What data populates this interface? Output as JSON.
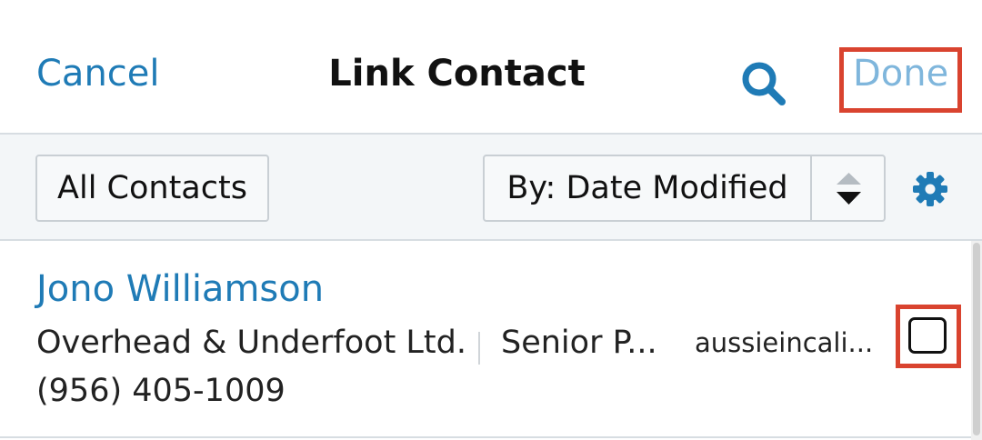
{
  "header": {
    "cancel_label": "Cancel",
    "title": "Link Contact",
    "done_label": "Done"
  },
  "toolbar": {
    "filter_label": "All Contacts",
    "sort_label": "By: Date Modified"
  },
  "records": [
    {
      "name": "Jono Williamson",
      "company": "Overhead & Underfoot Ltd.",
      "title": "Senior P...",
      "email": "aussieincali...",
      "phone": "(956) 405-1009",
      "checked": false
    }
  ],
  "icons": {
    "search": "search-icon",
    "sort": "sort-arrows-icon",
    "settings": "gear-icon"
  },
  "colors": {
    "link": "#1f7bb6",
    "done_disabled": "#7fb6dc",
    "highlight": "#d9432f"
  }
}
